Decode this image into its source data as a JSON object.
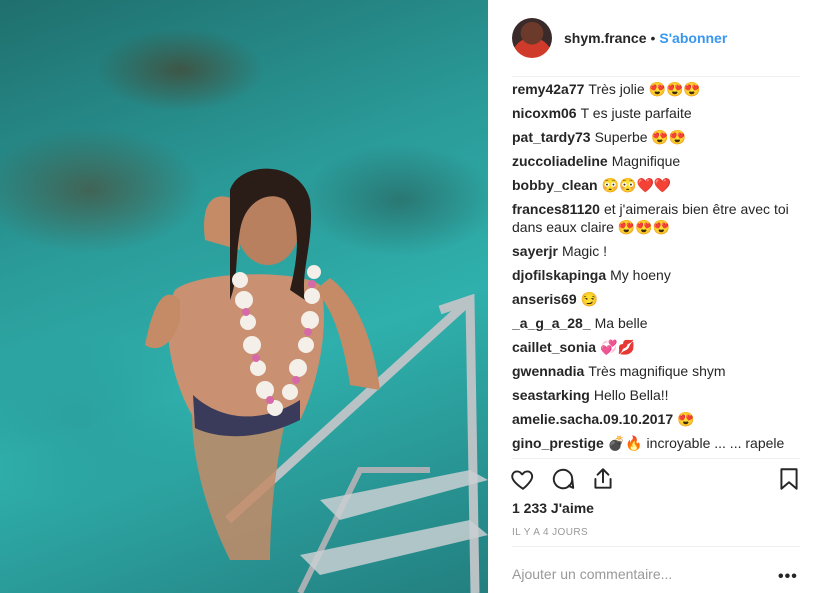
{
  "header": {
    "username": "shym.france",
    "separator": "•",
    "follow_label": "S'abonner"
  },
  "comments": [
    {
      "user": "remy42a77",
      "text": "Très jolie 😍😍😍"
    },
    {
      "user": "nicoxm06",
      "text": "T es juste parfaite"
    },
    {
      "user": "pat_tardy73",
      "text": "Superbe 😍😍"
    },
    {
      "user": "zuccoliadeline",
      "text": "Magnifique"
    },
    {
      "user": "bobby_clean",
      "text": "😳😳❤️❤️"
    },
    {
      "user": "frances81120",
      "text": "et j'aimerais bien être avec toi dans eaux claire 😍😍😍"
    },
    {
      "user": "sayerjr",
      "text": "Magic !"
    },
    {
      "user": "djofilskapinga",
      "text": "My hoeny"
    },
    {
      "user": "anseris69",
      "text": "😏"
    },
    {
      "user": "_a_g_a_28_",
      "text": "Ma belle"
    },
    {
      "user": "caillet_sonia",
      "text": "💞💋"
    },
    {
      "user": "gwennadia",
      "text": "Très magnifique shym"
    },
    {
      "user": "seastarking",
      "text": "Hello Bella!!"
    },
    {
      "user": "amelie.sacha.09.10.2017",
      "text": "😍"
    },
    {
      "user": "gino_prestige",
      "text": "💣🔥 incroyable ... ... rapele"
    }
  ],
  "actions": {
    "like_icon": "heart-icon",
    "comment_icon": "comment-icon",
    "share_icon": "share-icon",
    "save_icon": "bookmark-icon"
  },
  "likes_text": "1 233 J'aime",
  "time_text": "IL Y A 4 JOURS",
  "add_comment_placeholder": "Ajouter un commentaire...",
  "more_label": "•••",
  "colors": {
    "accent": "#3897f0",
    "text": "#262626",
    "muted": "#999999",
    "water": "#2fb0ac"
  }
}
